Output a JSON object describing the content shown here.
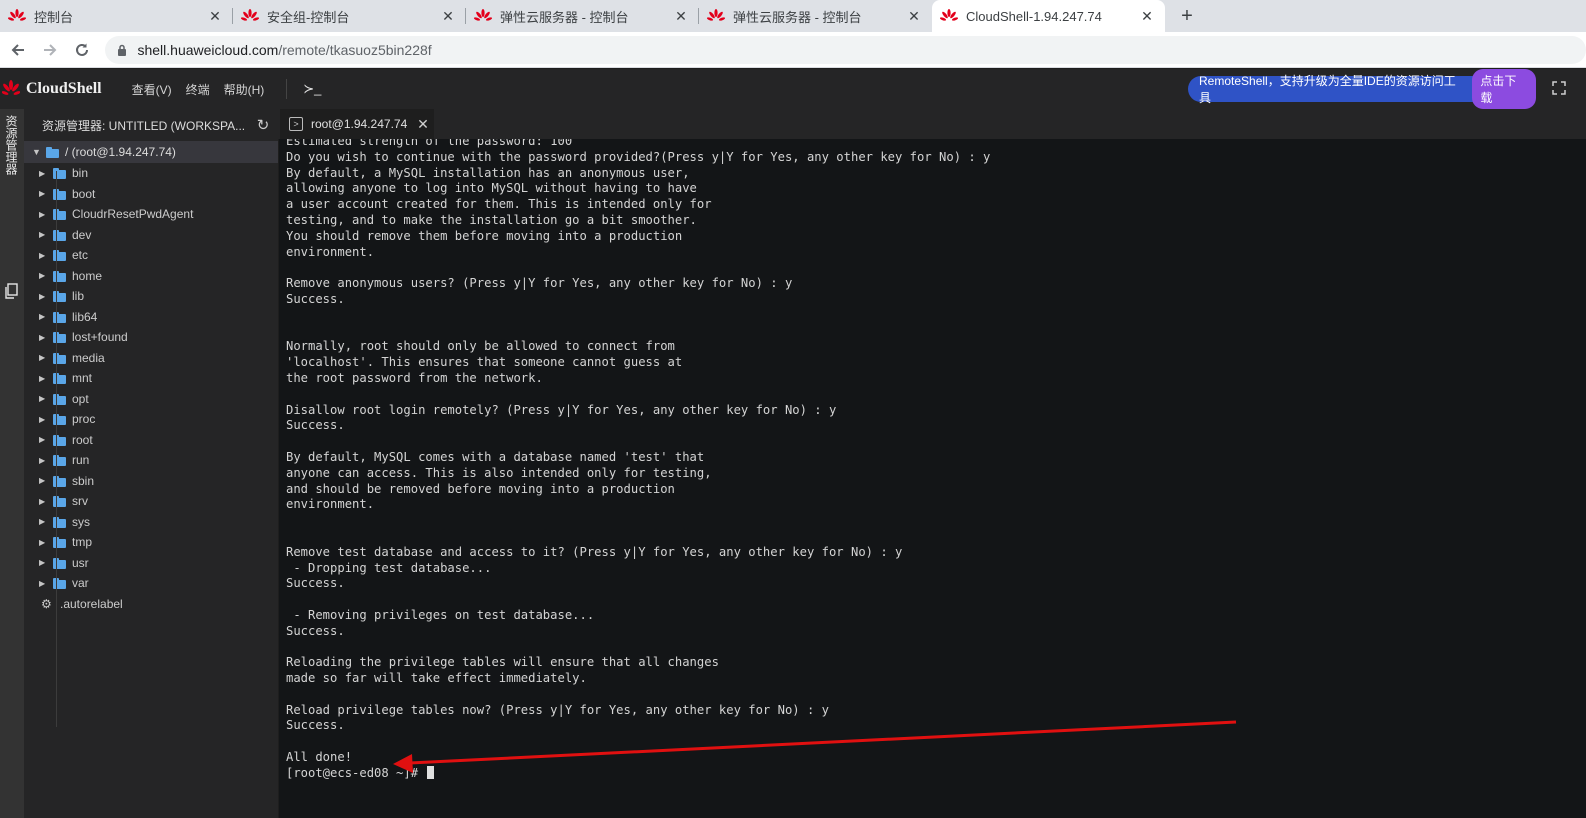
{
  "browser": {
    "tabs": [
      {
        "title": "控制台",
        "active": false
      },
      {
        "title": "安全组-控制台",
        "active": false
      },
      {
        "title": "弹性云服务器 - 控制台",
        "active": false
      },
      {
        "title": "弹性云服务器 - 控制台",
        "active": false
      },
      {
        "title": "CloudShell-1.94.247.74",
        "active": true
      }
    ],
    "close_glyph": "✕",
    "new_tab_glyph": "+",
    "url_host": "shell.huaweicloud.com",
    "url_path": "/remote/tkasuoz5bin228f",
    "favicon_color": "#e3001b"
  },
  "app": {
    "brand": "CloudShell",
    "menu": [
      "查看(V)",
      "终端",
      "帮助(H)"
    ],
    "terminal_icon": "≻_",
    "banner_text": "RemoteShell，支持升级为全量IDE的资源访问工具",
    "banner_button": "点击下载",
    "banner_color": "#2f53c6",
    "banner_button_color": "#8c4be0"
  },
  "activity_bar": {
    "label": "资源管理器"
  },
  "explorer": {
    "title": "资源管理器: UNTITLED (WORKSPA...",
    "root": "/ (root@1.94.247.74)",
    "folders": [
      "bin",
      "boot",
      "CloudrResetPwdAgent",
      "dev",
      "etc",
      "home",
      "lib",
      "lib64",
      "lost+found",
      "media",
      "mnt",
      "opt",
      "proc",
      "root",
      "run",
      "sbin",
      "srv",
      "sys",
      "tmp",
      "usr",
      "var"
    ],
    "files": [
      ".autorelabel"
    ],
    "folder_color": "#5aa6e8"
  },
  "editor": {
    "tab_title": "root@1.94.247.74"
  },
  "terminal": {
    "text": "Estimated strength of the password: 100\nDo you wish to continue with the password provided?(Press y|Y for Yes, any other key for No) : y\nBy default, a MySQL installation has an anonymous user,\nallowing anyone to log into MySQL without having to have\na user account created for them. This is intended only for\ntesting, and to make the installation go a bit smoother.\nYou should remove them before moving into a production\nenvironment.\n\nRemove anonymous users? (Press y|Y for Yes, any other key for No) : y\nSuccess.\n\n\nNormally, root should only be allowed to connect from\n'localhost'. This ensures that someone cannot guess at\nthe root password from the network.\n\nDisallow root login remotely? (Press y|Y for Yes, any other key for No) : y\nSuccess.\n\nBy default, MySQL comes with a database named 'test' that\nanyone can access. This is also intended only for testing,\nand should be removed before moving into a production\nenvironment.\n\n\nRemove test database and access to it? (Press y|Y for Yes, any other key for No) : y\n - Dropping test database...\nSuccess.\n\n - Removing privileges on test database...\nSuccess.\n\nReloading the privilege tables will ensure that all changes\nmade so far will take effect immediately.\n\nReload privilege tables now? (Press y|Y for Yes, any other key for No) : y\nSuccess.\n\nAll done!\n",
    "prompt": "[root@ecs-ed08 ~]# ",
    "annotation_color": "#e01010"
  }
}
